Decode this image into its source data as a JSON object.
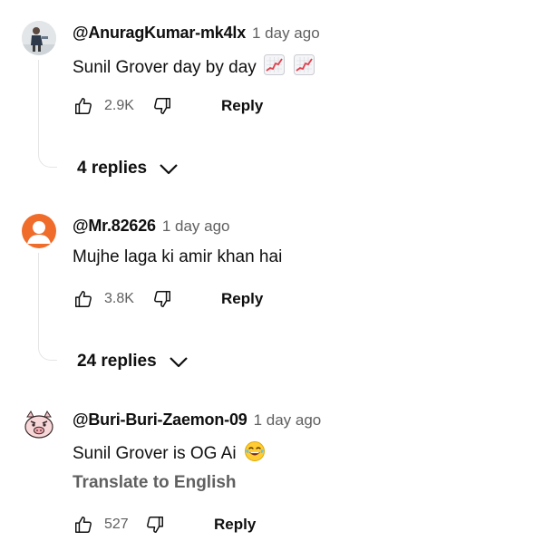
{
  "comments": [
    {
      "author": "@AnuragKumar-mk4lx",
      "time": "1 day ago",
      "text": "Sunil Grover day by day",
      "emojis": [
        "chart-increasing-icon",
        "chart-increasing-icon"
      ],
      "likes": "2.9K",
      "reply_label": "Reply",
      "replies_label": "4 replies",
      "avatar": "photo-avatar"
    },
    {
      "author": "@Mr.82626",
      "time": "1 day ago",
      "text": "Mujhe laga ki amir khan hai",
      "likes": "3.8K",
      "reply_label": "Reply",
      "replies_label": "24 replies",
      "avatar": "default-person-avatar",
      "avatar_color": "#ef6c2b"
    },
    {
      "author": "@Buri-Buri-Zaemon-09",
      "time": "1 day ago",
      "text": "Sunil Grover is OG Ai",
      "emojis": [
        "face-with-tears-of-joy-icon"
      ],
      "translate_label": "Translate to English",
      "likes": "527",
      "reply_label": "Reply",
      "avatar": "pig-cartoon-avatar"
    }
  ],
  "colors": {
    "primary_text": "#0f0f0f",
    "secondary_text": "#606060",
    "thread_line": "#e5e5e5"
  }
}
